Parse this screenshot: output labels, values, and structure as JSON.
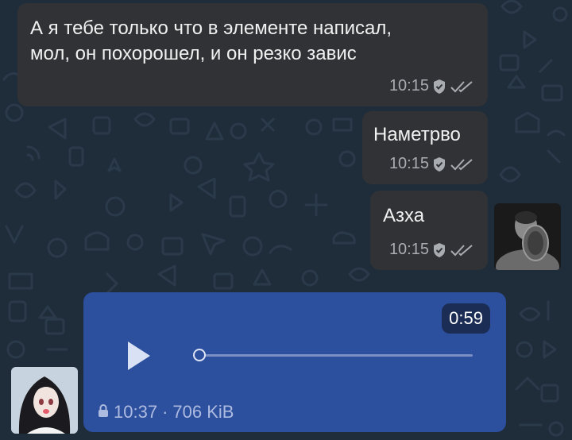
{
  "messages": [
    {
      "text": "А я тебе только что в элементе написал,\nмол, он похорошел, и он резко завис",
      "time": "10:15"
    },
    {
      "text": "Наметрво",
      "time": "10:15"
    },
    {
      "text": "Азха",
      "time": "10:15"
    }
  ],
  "voice": {
    "duration": "0:59",
    "time": "10:37",
    "separator": "·",
    "size": "706 KiB",
    "progress": 0
  },
  "icons": {
    "read_status": "double-check-icon",
    "verified": "shield-check-icon",
    "lock": "lock-icon",
    "play": "play-icon"
  },
  "colors": {
    "background": "#1f2c3a",
    "incoming_bubble": "#303236",
    "voice_bubble": "#2c4f9e",
    "duration_badge": "#1b2d55"
  }
}
